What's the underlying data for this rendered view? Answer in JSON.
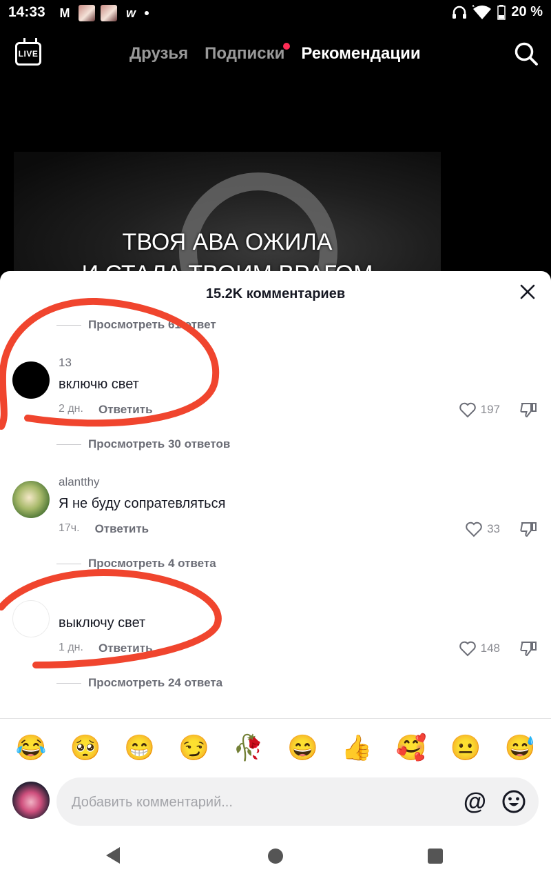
{
  "status_bar": {
    "time": "14:33",
    "mail_icon": "M",
    "app_icon_w": "w",
    "battery": "20 %"
  },
  "top_nav": {
    "live_label": "LIVE",
    "tabs": [
      {
        "label": "Друзья"
      },
      {
        "label": "Подписки"
      },
      {
        "label": "Рекомендации"
      }
    ]
  },
  "video": {
    "caption_line1": "ТВОЯ АВА ОЖИЛА",
    "caption_line2": "И СТАЛА ТВОИМ ВРАГОМ"
  },
  "comments_sheet": {
    "title": "15.2K комментариев",
    "top_reply_link": "Просмотреть 61 ответ",
    "reply_label": "Ответить",
    "comments": [
      {
        "username": "13",
        "text": "включю свет",
        "time": "2 дн.",
        "likes": "197",
        "view_replies": "Просмотреть 30 ответов"
      },
      {
        "username": "alantthy",
        "text": "Я не буду сопратевляться",
        "time": "17ч.",
        "likes": "33",
        "view_replies": "Просмотреть 4 ответа"
      },
      {
        "username": "",
        "text": "выключу свет",
        "time": "1 дн.",
        "likes": "148",
        "view_replies": "Просмотреть 24 ответа"
      }
    ],
    "emojis": [
      "😂",
      "🥺",
      "😁",
      "😏",
      "🥀",
      "😄",
      "👍",
      "🥰",
      "😐",
      "😅"
    ],
    "input_placeholder": "Добавить комментарий...",
    "at_symbol": "@"
  },
  "colors": {
    "accent_red": "#fe2c55",
    "annotation_red": "#f0452e"
  }
}
